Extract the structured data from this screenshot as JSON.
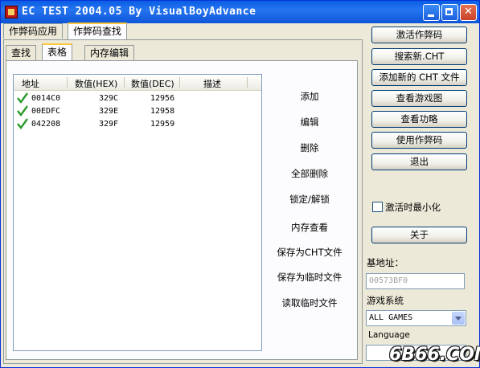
{
  "window": {
    "title": "EC TEST 2004.05  By VisualBoyAdvance"
  },
  "top_tabs": [
    "作弊码应用",
    "作弊码查找"
  ],
  "sub_tabs": [
    "查找",
    "表格",
    "内存编辑"
  ],
  "table": {
    "headers": [
      "地址",
      "数值(HEX)",
      "数值(DEC)",
      "描述"
    ],
    "rows": [
      {
        "address": "0014C0",
        "hex": "329C",
        "dec": "12956",
        "desc": ""
      },
      {
        "address": "00EDFC",
        "hex": "329E",
        "dec": "12958",
        "desc": ""
      },
      {
        "address": "042208",
        "hex": "329F",
        "dec": "12959",
        "desc": ""
      }
    ]
  },
  "actions": [
    "添加",
    "编辑",
    "删除",
    "全部删除",
    "锁定/解锁",
    "内存查看",
    "保存为CHT文件",
    "保存为临时文件",
    "读取临时文件"
  ],
  "right_buttons": [
    "激活作弊码",
    "搜索新.CHT",
    "添加新的 CHT 文件",
    "查看游戏图",
    "查看功略",
    "使用作弊码",
    "退出"
  ],
  "minimize_checkbox": {
    "label": "激活时最小化",
    "checked": false
  },
  "about_button": "关于",
  "base_address": {
    "label": "基地址：",
    "value": "00573BF0"
  },
  "game_system": {
    "label": "游戏系统",
    "selected": "ALL GAMES"
  },
  "language": {
    "label": "Language",
    "value": ""
  },
  "watermark": "6B66.COM",
  "colors": {
    "titlebar": "#0a5ee4",
    "check": "#2a9a2a",
    "tab_accent": "#ffc83c"
  }
}
